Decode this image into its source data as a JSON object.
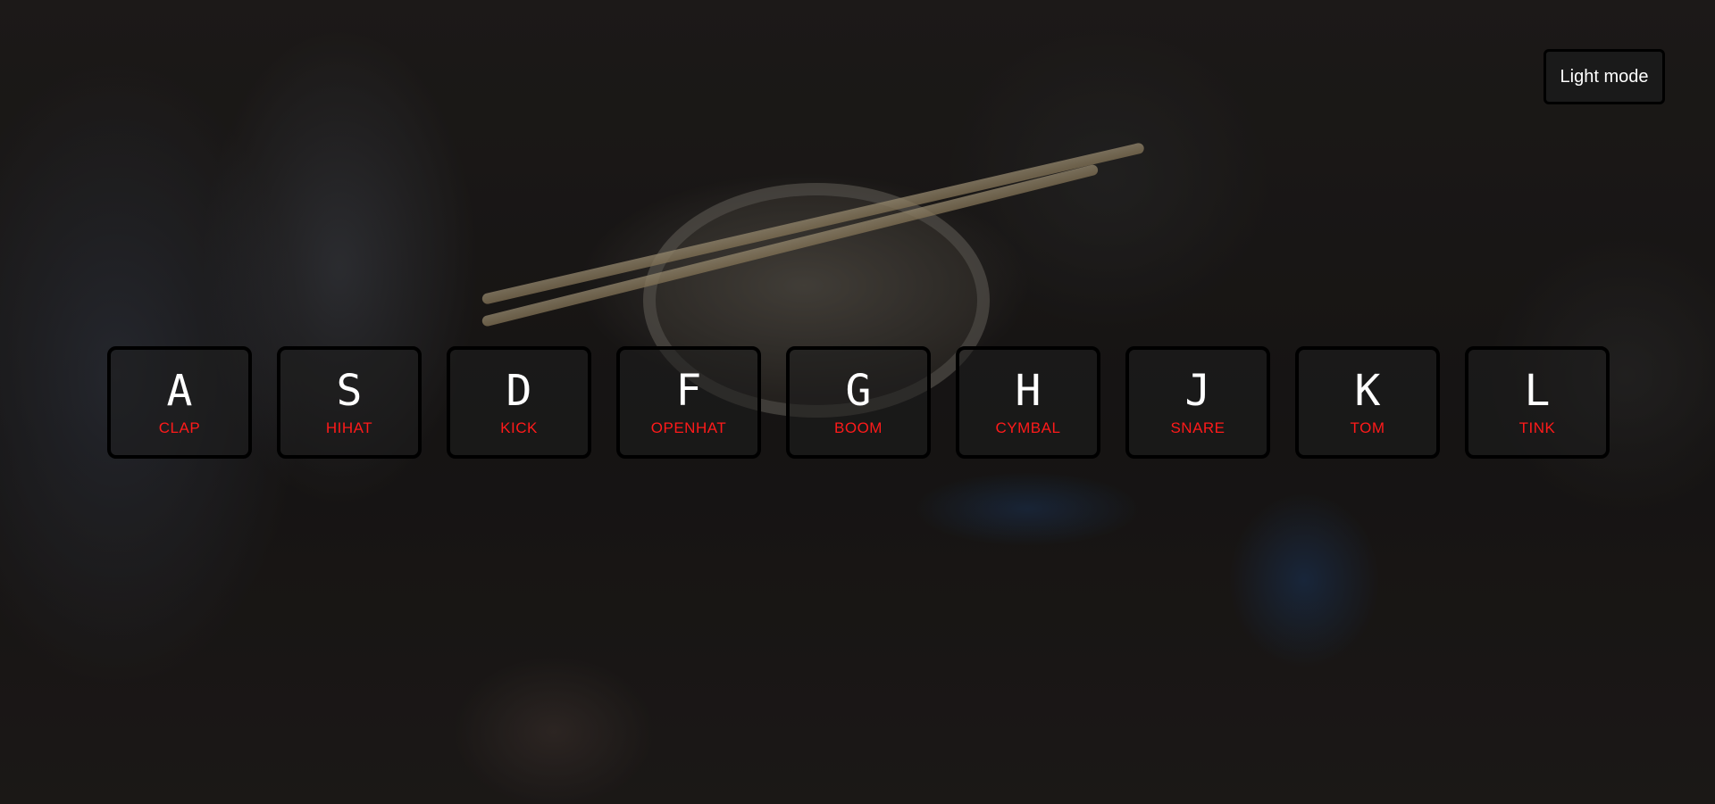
{
  "theme_toggle": {
    "label": "Light mode"
  },
  "keys": [
    {
      "letter": "A",
      "sound": "CLAP"
    },
    {
      "letter": "S",
      "sound": "HIHAT"
    },
    {
      "letter": "D",
      "sound": "KICK"
    },
    {
      "letter": "F",
      "sound": "OPENHAT"
    },
    {
      "letter": "G",
      "sound": "BOOM"
    },
    {
      "letter": "H",
      "sound": "CYMBAL"
    },
    {
      "letter": "J",
      "sound": "SNARE"
    },
    {
      "letter": "K",
      "sound": "TOM"
    },
    {
      "letter": "L",
      "sound": "TINK"
    }
  ],
  "colors": {
    "key_letter": "#ffffff",
    "key_sound": "#ff1a1a",
    "key_border": "#000000"
  }
}
